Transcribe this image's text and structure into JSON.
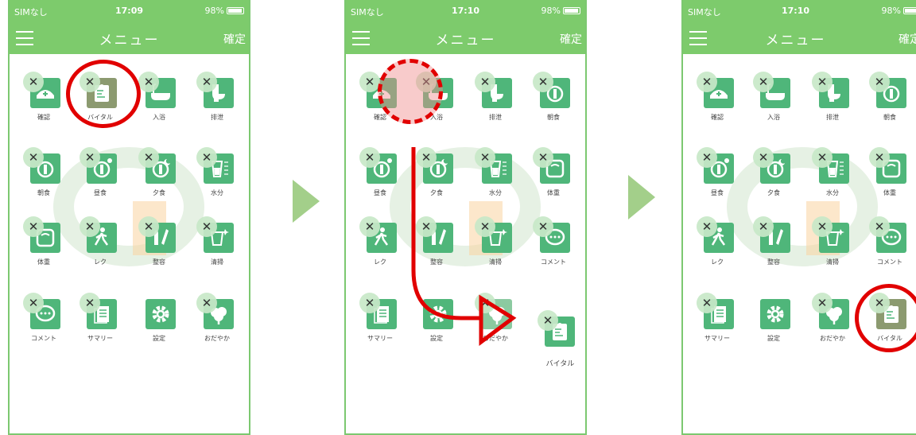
{
  "screens": [
    {
      "status": {
        "carrier": "SIMなし",
        "time": "17:09",
        "battery": "98%"
      },
      "nav": {
        "title": "メニュー",
        "confirm": "確定"
      },
      "tiles": [
        {
          "label": "確認",
          "icon": "cap-icon"
        },
        {
          "label": "バイタル",
          "icon": "vital-icon"
        },
        {
          "label": "入浴",
          "icon": "bath-icon"
        },
        {
          "label": "排泄",
          "icon": "toilet-icon"
        },
        {
          "label": "朝食",
          "icon": "breakfast-icon"
        },
        {
          "label": "昼食",
          "icon": "lunch-icon"
        },
        {
          "label": "夕食",
          "icon": "dinner-icon"
        },
        {
          "label": "水分",
          "icon": "water-icon"
        },
        {
          "label": "体重",
          "icon": "scale-icon"
        },
        {
          "label": "レク",
          "icon": "walk-icon"
        },
        {
          "label": "整容",
          "icon": "groom-icon"
        },
        {
          "label": "清掃",
          "icon": "clean-icon"
        },
        {
          "label": "コメント",
          "icon": "comment-icon"
        },
        {
          "label": "サマリー",
          "icon": "summary-icon"
        },
        {
          "label": "設定",
          "icon": "gear-icon"
        },
        {
          "label": "おだやか",
          "icon": "calm-icon"
        }
      ]
    },
    {
      "status": {
        "carrier": "SIMなし",
        "time": "17:10",
        "battery": "98%"
      },
      "nav": {
        "title": "メニュー",
        "confirm": "確定"
      },
      "tiles": [
        {
          "label": "確認",
          "icon": "cap-icon"
        },
        {
          "label": "入浴",
          "icon": "bath-icon"
        },
        {
          "label": "排泄",
          "icon": "toilet-icon"
        },
        {
          "label": "朝食",
          "icon": "breakfast-icon"
        },
        {
          "label": "昼食",
          "icon": "lunch-icon"
        },
        {
          "label": "夕食",
          "icon": "dinner-icon"
        },
        {
          "label": "水分",
          "icon": "water-icon"
        },
        {
          "label": "体重",
          "icon": "scale-icon"
        },
        {
          "label": "レク",
          "icon": "walk-icon"
        },
        {
          "label": "整容",
          "icon": "groom-icon"
        },
        {
          "label": "清掃",
          "icon": "clean-icon"
        },
        {
          "label": "コメント",
          "icon": "comment-icon"
        },
        {
          "label": "サマリー",
          "icon": "summary-icon"
        },
        {
          "label": "設定",
          "icon": "gear-icon"
        },
        {
          "label": "おだやか",
          "icon": "calm-icon"
        }
      ],
      "dragging": {
        "label": "バイタル",
        "icon": "vital-icon"
      }
    },
    {
      "status": {
        "carrier": "SIMなし",
        "time": "17:10",
        "battery": "98%"
      },
      "nav": {
        "title": "メニュー",
        "confirm": "確定"
      },
      "tiles": [
        {
          "label": "確認",
          "icon": "cap-icon"
        },
        {
          "label": "入浴",
          "icon": "bath-icon"
        },
        {
          "label": "排泄",
          "icon": "toilet-icon"
        },
        {
          "label": "朝食",
          "icon": "breakfast-icon"
        },
        {
          "label": "昼食",
          "icon": "lunch-icon"
        },
        {
          "label": "夕食",
          "icon": "dinner-icon"
        },
        {
          "label": "水分",
          "icon": "water-icon"
        },
        {
          "label": "体重",
          "icon": "scale-icon"
        },
        {
          "label": "レク",
          "icon": "walk-icon"
        },
        {
          "label": "整容",
          "icon": "groom-icon"
        },
        {
          "label": "清掃",
          "icon": "clean-icon"
        },
        {
          "label": "コメント",
          "icon": "comment-icon"
        },
        {
          "label": "サマリー",
          "icon": "summary-icon"
        },
        {
          "label": "設定",
          "icon": "gear-icon"
        },
        {
          "label": "おだやか",
          "icon": "calm-icon"
        },
        {
          "label": "バイタル",
          "icon": "vital-icon"
        }
      ]
    }
  ],
  "colors": {
    "brand": "#7dcb6c",
    "tile": "#4fb67a",
    "highlight": "#e10000",
    "step_arrow": "#a3cf8a"
  }
}
